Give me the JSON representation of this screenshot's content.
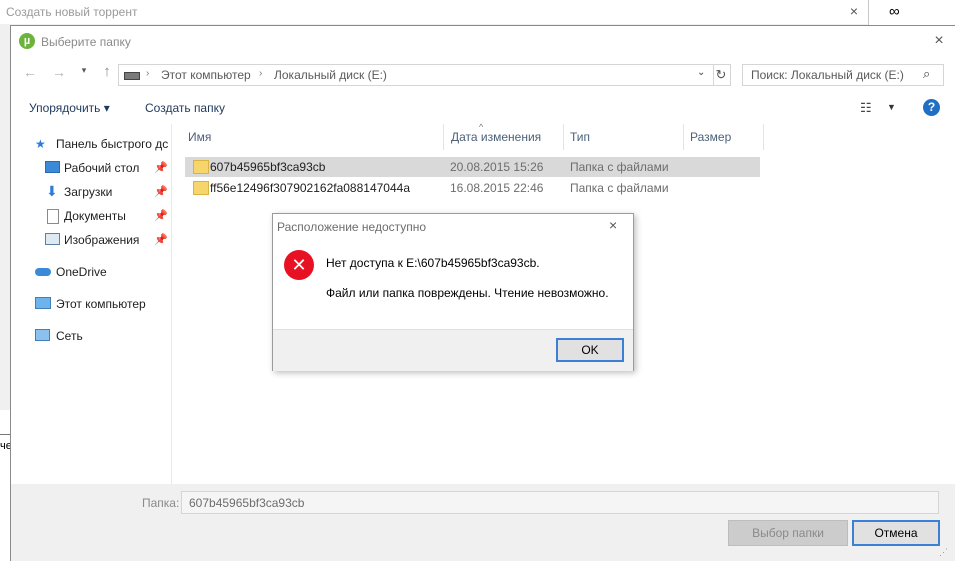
{
  "background_window": {
    "title": "Создать новый торрент",
    "close_icon": "×",
    "infinity": "∞",
    "fragment": "че"
  },
  "dialog": {
    "title": "Выберите папку",
    "app_icon": "µ",
    "close_icon": "×",
    "nav": {
      "back_icon": "←",
      "forward_icon": "→",
      "recent_icon": "▾",
      "up_icon": "↑",
      "crumb_sep": "›",
      "breadcrumb": [
        "Этот компьютер",
        "Локальный диск (E:)"
      ],
      "address_dropdown_icon": "⌄",
      "refresh_icon": "↻",
      "search_placeholder": "Поиск: Локальный диск (E:)",
      "search_icon": "⌕"
    },
    "toolbar": {
      "organize_label": "Упорядочить ▾",
      "new_folder_label": "Создать папку",
      "view_icon": "☷",
      "view_dropdown_icon": "▼",
      "help_icon": "?"
    },
    "sidebar": {
      "pin_icon": "📌",
      "items": [
        {
          "label": "Панель быстрого дс",
          "icon": "star-icon"
        },
        {
          "label": "Рабочий стол",
          "icon": "desktop-icon"
        },
        {
          "label": "Загрузки",
          "icon": "download-icon"
        },
        {
          "label": "Документы",
          "icon": "documents-icon"
        },
        {
          "label": "Изображения",
          "icon": "pictures-icon"
        },
        {
          "label": "OneDrive",
          "icon": "cloud-icon"
        },
        {
          "label": "Этот компьютер",
          "icon": "computer-icon"
        },
        {
          "label": "Сеть",
          "icon": "network-icon"
        }
      ]
    },
    "file_list": {
      "sort_icon": "^",
      "columns": [
        "Имя",
        "Дата изменения",
        "Тип",
        "Размер"
      ],
      "rows": [
        {
          "name": "607b45965bf3ca93cb",
          "date": "20.08.2015 15:26",
          "type": "Папка с файлами",
          "selected": true
        },
        {
          "name": "ff56e12496f307902162fa088147044a",
          "date": "16.08.2015 22:46",
          "type": "Папка с файлами",
          "selected": false
        }
      ]
    },
    "bottom": {
      "folder_label": "Папка:",
      "folder_value": "607b45965bf3ca93cb",
      "select_button": "Выбор папки",
      "cancel_button": "Отмена",
      "grip_icon": "⋰"
    }
  },
  "error_dialog": {
    "title": "Расположение недоступно",
    "close_icon": "×",
    "error_icon": "✕",
    "message_line1": "Нет доступа к E:\\607b45965bf3ca93cb.",
    "message_line2": "Файл или папка повреждены. Чтение невозможно.",
    "ok_button": "OK"
  },
  "colors": {
    "accent": "#3c7fd6",
    "error": "#e81123",
    "selection": "#d9d9d9",
    "folder": "#f5d56c"
  }
}
